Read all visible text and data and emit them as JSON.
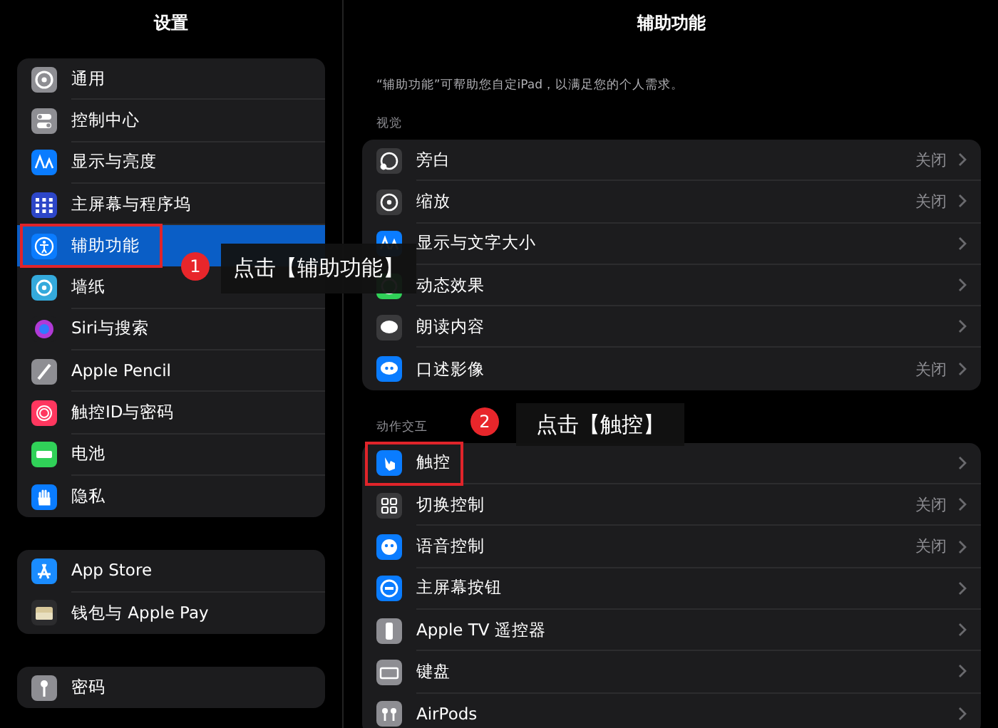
{
  "sidebar": {
    "title": "设置",
    "groups": [
      [
        {
          "label": "通用",
          "selected": false,
          "outlined": false
        },
        {
          "label": "控制中心",
          "selected": false,
          "outlined": false
        },
        {
          "label": "显示与亮度",
          "selected": false,
          "outlined": false
        },
        {
          "label": "主屏幕与程序坞",
          "selected": false,
          "outlined": false
        },
        {
          "label": "辅助功能",
          "selected": true,
          "outlined": true
        },
        {
          "label": "墙纸",
          "selected": false,
          "outlined": false
        },
        {
          "label": "Siri与搜索",
          "selected": false,
          "outlined": false
        },
        {
          "label": "Apple Pencil",
          "selected": false,
          "outlined": false
        },
        {
          "label": "触控ID与密码",
          "selected": false,
          "outlined": false
        },
        {
          "label": "电池",
          "selected": false,
          "outlined": false
        },
        {
          "label": "隐私",
          "selected": false,
          "outlined": false
        }
      ],
      [
        {
          "label": "App Store",
          "selected": false,
          "outlined": false
        },
        {
          "label": "钱包与 Apple Pay",
          "selected": false,
          "outlined": false
        }
      ],
      [
        {
          "label": "密码",
          "selected": false,
          "outlined": false
        }
      ]
    ]
  },
  "detail": {
    "title": "辅助功能",
    "description": "“辅助功能”可帮助您自定iPad，以满足您的个人需求。",
    "sections": [
      {
        "header": "视觉",
        "rows": [
          {
            "label": "旁白",
            "value": "关闭",
            "outlined": false
          },
          {
            "label": "缩放",
            "value": "关闭",
            "outlined": false
          },
          {
            "label": "显示与文字大小",
            "outlined": false
          },
          {
            "label": "动态效果",
            "outlined": false
          },
          {
            "label": "朗读内容",
            "outlined": false
          },
          {
            "label": "口述影像",
            "value": "关闭",
            "outlined": false
          }
        ]
      },
      {
        "header": "动作交互",
        "rows": [
          {
            "label": "触控",
            "outlined": true
          },
          {
            "label": "切换控制",
            "value": "关闭",
            "outlined": false
          },
          {
            "label": "语音控制",
            "value": "关闭",
            "outlined": false
          },
          {
            "label": "主屏幕按钮",
            "outlined": false
          },
          {
            "label": "Apple TV 遥控器",
            "outlined": false
          },
          {
            "label": "键盘",
            "outlined": false
          },
          {
            "label": "AirPods",
            "outlined": false
          }
        ]
      }
    ]
  },
  "annotations": [
    {
      "number": "1",
      "text": "点击【辅助功能】"
    },
    {
      "number": "2",
      "text": "点击【触控】"
    }
  ]
}
